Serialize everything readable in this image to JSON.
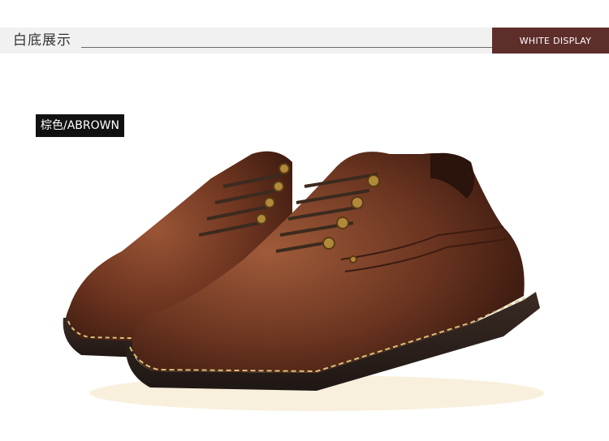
{
  "header": {
    "title": "白底展示",
    "badge": "WHITE DISPLAY"
  },
  "product": {
    "color_label": "棕色/ABROWN",
    "image_alt": "brown leather lace-up shoes, pair",
    "colors": {
      "leather": "#6a3420",
      "sole": "#2e2420",
      "stitch": "#d9c27a",
      "eyelet": "#b08a3a",
      "accent": "#5e2e2a"
    }
  }
}
